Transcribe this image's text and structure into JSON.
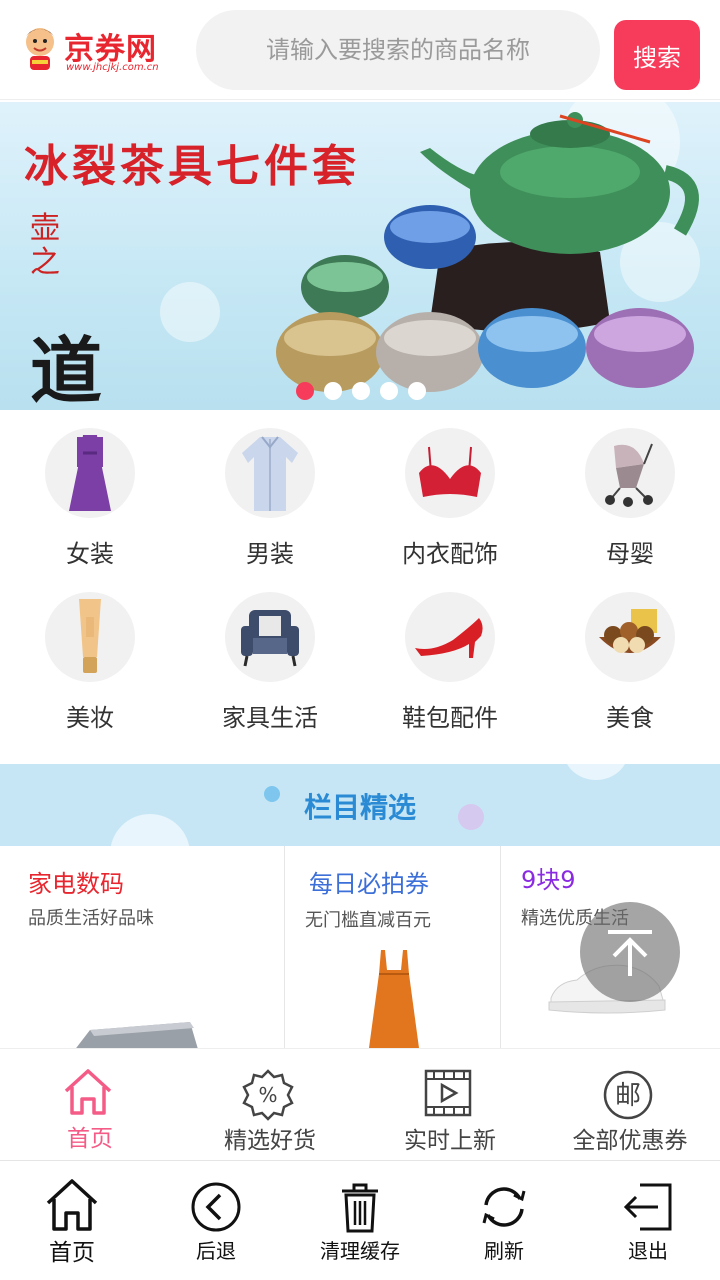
{
  "header": {
    "brand": "京券网",
    "url": "www.jhcjkj.com.cn",
    "search_placeholder": "请输入要搜索的商品名称",
    "search_button": "搜索"
  },
  "banner": {
    "title": "冰裂茶具七件套",
    "poem_big": "道",
    "poem_small": "壶之",
    "slides": 5,
    "active_slide": 1
  },
  "categories": [
    {
      "label": "女装",
      "icon": "dress-icon"
    },
    {
      "label": "男装",
      "icon": "shirt-icon"
    },
    {
      "label": "内衣配饰",
      "icon": "bra-icon"
    },
    {
      "label": "母婴",
      "icon": "stroller-icon"
    },
    {
      "label": "美妆",
      "icon": "cosmetic-tube-icon"
    },
    {
      "label": "家具生活",
      "icon": "armchair-icon"
    },
    {
      "label": "鞋包配件",
      "icon": "high-heel-icon"
    },
    {
      "label": "美食",
      "icon": "nuts-icon"
    }
  ],
  "section": {
    "title": "栏目精选"
  },
  "cards": [
    {
      "title": "家电数码",
      "subtitle": "品质生活好品味",
      "color": "#e8262f"
    },
    {
      "title": "每日必拍券",
      "subtitle": "无门槛直减百元",
      "color": "#3c6fd8"
    },
    {
      "title": "9块9",
      "subtitle": "精选优质生活",
      "color": "#8a2be2"
    }
  ],
  "tabs": [
    {
      "label": "首页",
      "icon": "home-icon",
      "active": true
    },
    {
      "label": "精选好货",
      "icon": "percent-badge-icon",
      "active": false
    },
    {
      "label": "实时上新",
      "icon": "video-play-icon",
      "active": false
    },
    {
      "label": "全部优惠券",
      "icon": "mail-stamp-icon",
      "active": false
    }
  ],
  "toolbar": [
    {
      "label": "首页",
      "icon": "home-icon"
    },
    {
      "label": "后退",
      "icon": "back-icon"
    },
    {
      "label": "清理缓存",
      "icon": "trash-icon"
    },
    {
      "label": "刷新",
      "icon": "refresh-icon"
    },
    {
      "label": "退出",
      "icon": "exit-icon"
    }
  ],
  "colors": {
    "accent": "#f73b5b",
    "tab_active": "#f45b86",
    "section_bg": "#c6e6f6",
    "section_title": "#2a8bd4"
  }
}
